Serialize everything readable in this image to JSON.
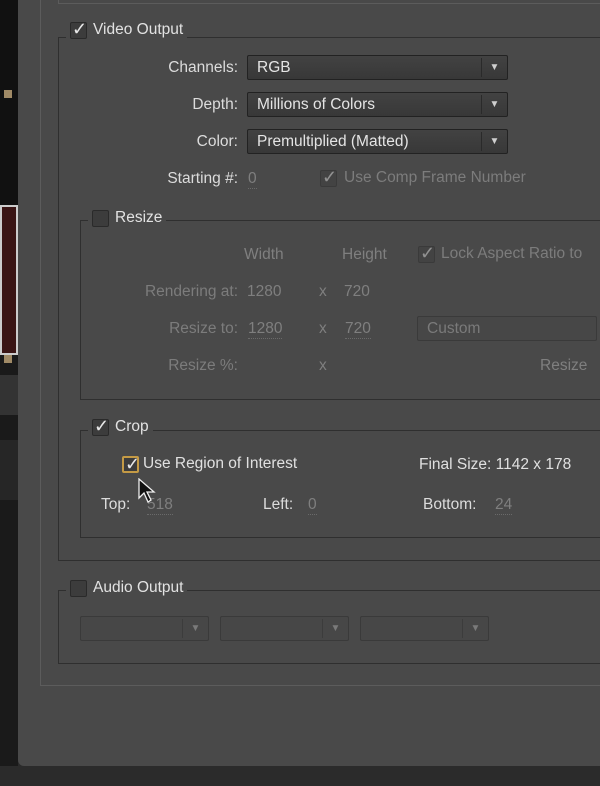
{
  "video_output": {
    "label": "Video Output",
    "checked": true,
    "channels": {
      "label": "Channels:",
      "value": "RGB"
    },
    "depth": {
      "label": "Depth:",
      "value": "Millions of Colors"
    },
    "color": {
      "label": "Color:",
      "value": "Premultiplied (Matted)"
    },
    "starting": {
      "label": "Starting #:",
      "value": "0"
    },
    "use_comp_frame": {
      "label": "Use Comp Frame Number",
      "checked": true
    }
  },
  "resize": {
    "label": "Resize",
    "checked": false,
    "width_header": "Width",
    "height_header": "Height",
    "lock_aspect": {
      "label": "Lock Aspect Ratio to",
      "checked": true
    },
    "rendering_at": {
      "label": "Rendering at:",
      "width": "1280",
      "x": "x",
      "height": "720"
    },
    "resize_to": {
      "label": "Resize to:",
      "width": "1280",
      "x": "x",
      "height": "720",
      "preset": "Custom"
    },
    "resize_pct": {
      "label": "Resize %:",
      "x": "x",
      "quality_label": "Resize"
    }
  },
  "crop": {
    "label": "Crop",
    "checked": true,
    "use_roi": {
      "label": "Use Region of Interest",
      "checked": true
    },
    "final_size": "Final Size: 1142 x 178",
    "top": {
      "label": "Top:",
      "value": "518"
    },
    "left": {
      "label": "Left:",
      "value": "0"
    },
    "bottom": {
      "label": "Bottom:",
      "value": "24"
    }
  },
  "audio_output": {
    "label": "Audio Output",
    "checked": false
  },
  "colors": {
    "dialog_bg": "#494949",
    "focus": "#c49a45"
  }
}
